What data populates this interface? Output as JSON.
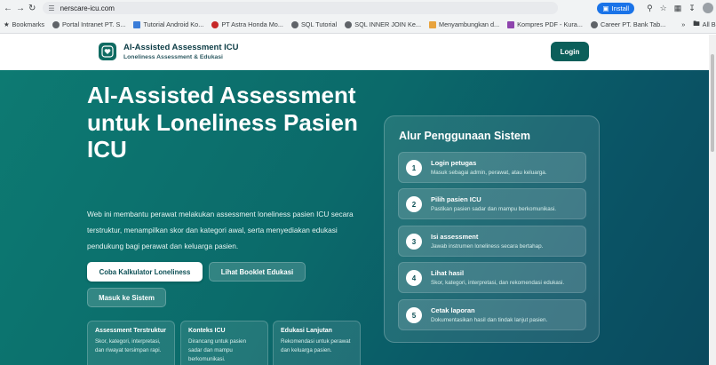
{
  "browser": {
    "url": "nerscare-icu.com",
    "install_label": "Install",
    "bookmarks": [
      "Bookmarks",
      "Portal Intranet PT. S...",
      "Tutorial Android Ko...",
      "PT Astra Honda Mo...",
      "SQL Tutorial",
      "SQL INNER JOIN Ke...",
      "Menyambungkan d...",
      "Kompres PDF - Kura...",
      "Career PT. Bank Tab..."
    ],
    "more_label": "»",
    "all_bookmarks": "All Bookmarks"
  },
  "header": {
    "title": "AI-Assisted Assessment ICU",
    "subtitle": "Loneliness Assessment & Edukasi",
    "login_label": "Login"
  },
  "hero": {
    "title": "AI-Assisted Assessment untuk Loneliness Pasien ICU",
    "description": "Web ini membantu perawat melakukan assessment loneliness pasien ICU secara terstruktur, menampilkan skor dan kategori awal, serta menyediakan edukasi pendukung bagi perawat dan keluarga pasien.",
    "btn_calculator": "Coba Kalkulator Loneliness",
    "btn_booklet": "Lihat Booklet Edukasi",
    "btn_masuk": "Masuk ke Sistem"
  },
  "features": [
    {
      "title": "Assessment Terstruktur",
      "desc": "Skor, kategori, interpretasi, dan riwayat tersimpan rapi."
    },
    {
      "title": "Konteks ICU",
      "desc": "Dirancang untuk pasien sadar dan mampu berkomunikasi."
    },
    {
      "title": "Edukasi Lanjutan",
      "desc": "Rekomendasi untuk perawat dan keluarga pasien."
    }
  ],
  "panel": {
    "title": "Alur Penggunaan Sistem",
    "steps": [
      {
        "num": "1",
        "title": "Login petugas",
        "desc": "Masuk sebagai admin, perawat, atau keluarga."
      },
      {
        "num": "2",
        "title": "Pilih pasien ICU",
        "desc": "Pastikan pasien sadar dan mampu berkomunikasi."
      },
      {
        "num": "3",
        "title": "Isi assessment",
        "desc": "Jawab instrumen loneliness secara bertahap."
      },
      {
        "num": "4",
        "title": "Lihat hasil",
        "desc": "Skor, kategori, interpretasi, dan rekomendasi edukasi."
      },
      {
        "num": "5",
        "title": "Cetak laporan",
        "desc": "Dokumentasikan hasil dan tindak lanjut pasien."
      }
    ]
  },
  "colors": {
    "brand_dark": "#0b5f5a",
    "hero_start": "#0d7a72",
    "hero_end": "#0a4a5e",
    "install_blue": "#1a73e8"
  }
}
